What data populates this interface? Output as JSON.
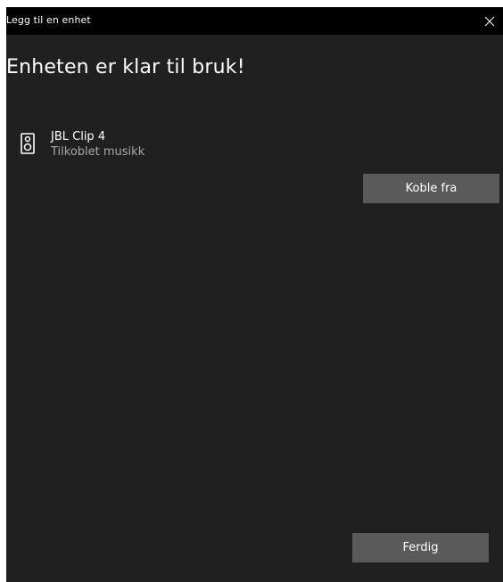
{
  "window": {
    "title": "Legg til en enhet",
    "close_icon": "close-icon"
  },
  "heading": "Enheten er klar til bruk!",
  "device": {
    "icon": "speaker-icon",
    "name": "JBL Clip 4",
    "status": "Tilkoblet musikk"
  },
  "buttons": {
    "disconnect_label": "Koble fra",
    "done_label": "Ferdig"
  },
  "colors": {
    "background": "#202020",
    "titlebar": "#000000",
    "button": "#5a5a5a",
    "secondary_text": "#a8a8a8"
  }
}
